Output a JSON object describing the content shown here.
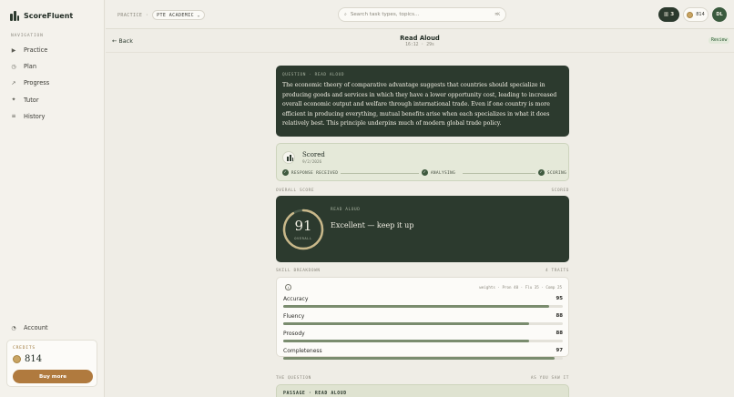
{
  "app": {
    "name": "ScoreFluent"
  },
  "sidebar": {
    "nav_title": "NAVIGATION",
    "items": [
      {
        "label": "Practice",
        "icon": "play-icon",
        "glyph": "▶"
      },
      {
        "label": "Plan",
        "icon": "calendar-icon",
        "glyph": "◷"
      },
      {
        "label": "Progress",
        "icon": "trend-icon",
        "glyph": "↗"
      },
      {
        "label": "Tutor",
        "icon": "sparkle-icon",
        "glyph": "✦"
      },
      {
        "label": "History",
        "icon": "list-icon",
        "glyph": "≡"
      }
    ],
    "account": "Account",
    "credits_label": "CREDITS",
    "credits_value": "814",
    "buy_label": "Buy more"
  },
  "topbar": {
    "crumb_prefix": "PRACTICE ·",
    "exam": "PTE ACADEMIC ⌄",
    "search_placeholder": "Search task types, topics...",
    "search_shortcut": "⌘K",
    "streak": "3",
    "coins": "814",
    "avatar": "DL"
  },
  "subheader": {
    "back": "← Back",
    "title": "Read Aloud",
    "meta": "16:12 · 29s",
    "badge": "Review"
  },
  "question": {
    "label": "QUESTION · READ ALOUD",
    "text": "The economic theory of comparative advantage suggests that countries should specialize in producing goods and services in which they have a lower opportunity cost, leading to increased overall economic output and welfare through international trade. Even if one country is more efficient in producing everything, mutual benefits arise when each specializes in what it does relatively best. This principle underpins much of modern global trade policy."
  },
  "status": {
    "title": "Scored",
    "date": "9/2/2026",
    "steps": [
      "RESPONSE RECEIVED",
      "ANALYSING",
      "SCORING"
    ]
  },
  "overall": {
    "section_left": "OVERALL SCORE",
    "section_right": "SCORED",
    "type": "READ ALOUD",
    "score": "91",
    "score_max": 100,
    "sub": "OVERALL",
    "message": "Excellent — keep it up"
  },
  "skills": {
    "section_left": "SKILL BREAKDOWN",
    "section_right": "4 TRAITS",
    "weights": "weights · Pron 40 · Flu 35 · Comp 25",
    "items": [
      {
        "name": "Accuracy",
        "value": 95
      },
      {
        "name": "Fluency",
        "value": 88
      },
      {
        "name": "Prosody",
        "value": 88
      },
      {
        "name": "Completeness",
        "value": 97
      }
    ]
  },
  "the_question": {
    "section_left": "THE QUESTION",
    "section_right": "AS YOU SAW IT",
    "passage_label": "PASSAGE · READ ALOUD"
  },
  "colors": {
    "primary": "#2c3a2e",
    "accent": "#b07a3e",
    "bar": "#7a8c6e",
    "ring": "#c9b88a"
  }
}
